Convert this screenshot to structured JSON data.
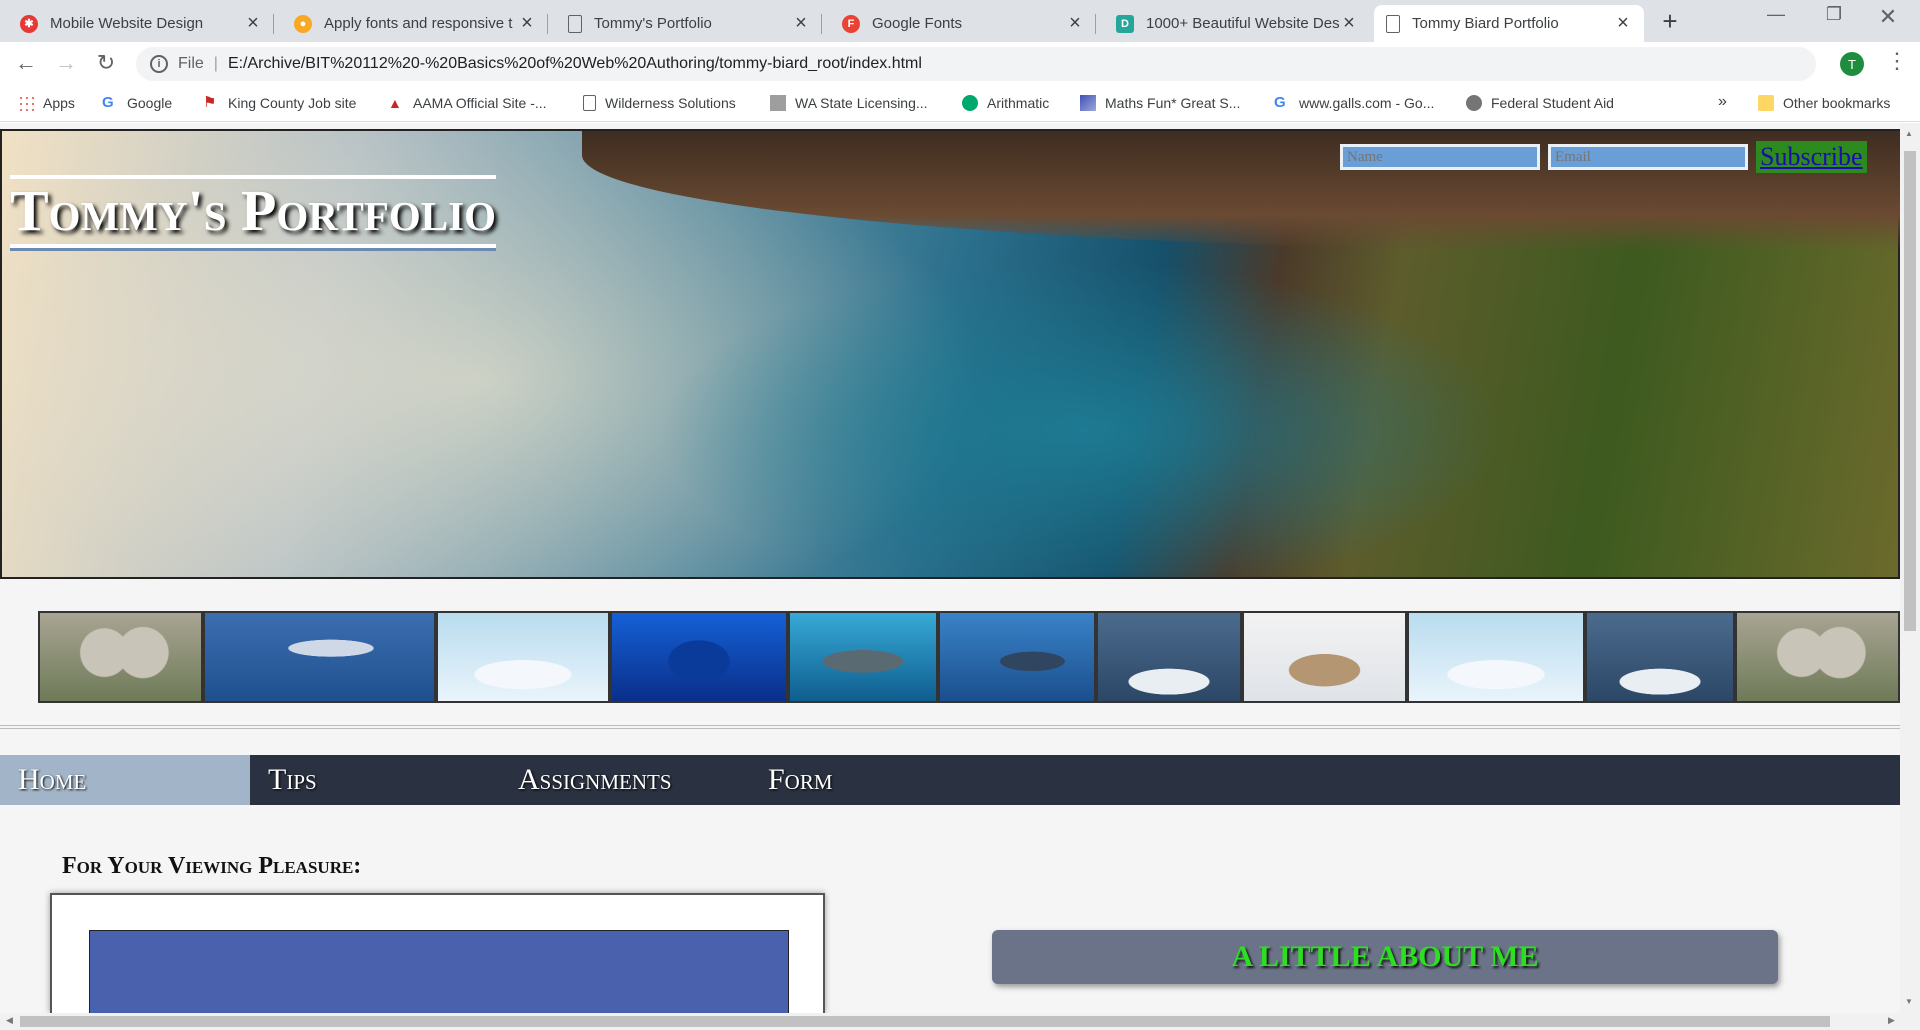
{
  "browser": {
    "tabs": [
      {
        "title": "Mobile Website Design",
        "icon": "mobile-site-icon",
        "color": "#e53935"
      },
      {
        "title": "Apply fonts and responsive t",
        "icon": "canvas-icon",
        "color": "#f9a825"
      },
      {
        "title": "Tommy's Portfolio",
        "icon": "page-icon",
        "color": "#5f6368"
      },
      {
        "title": "Google Fonts",
        "icon": "google-fonts-icon",
        "color": "#ea4335"
      },
      {
        "title": "1000+ Beautiful Website Des",
        "icon": "design-icon",
        "color": "#26a69a"
      },
      {
        "title": "Tommy Biard Portfolio",
        "icon": "page-icon",
        "color": "#5f6368"
      }
    ],
    "url_scheme": "File",
    "url": "E:/Archive/BIT%20112%20-%20Basics%20of%20Web%20Authoring/tommy-biard_root/index.html",
    "profile_initial": "T",
    "bookmarks": [
      {
        "label": "Apps",
        "icon": "apps-grid-icon"
      },
      {
        "label": "Google",
        "icon": "google-icon"
      },
      {
        "label": "King County Job site",
        "icon": "flag-icon"
      },
      {
        "label": "AAMA Official Site -...",
        "icon": "aama-icon"
      },
      {
        "label": "Wilderness Solutions",
        "icon": "page-icon"
      },
      {
        "label": "WA State Licensing...",
        "icon": "licensing-icon"
      },
      {
        "label": "Arithmatic",
        "icon": "arithmatic-icon"
      },
      {
        "label": "Maths Fun* Great S...",
        "icon": "maths-icon"
      },
      {
        "label": "www.galls.com - Go...",
        "icon": "google-icon"
      },
      {
        "label": "Federal Student Aid",
        "icon": "student-aid-icon"
      }
    ],
    "overflow_label": "»",
    "other_bookmarks": "Other bookmarks"
  },
  "page": {
    "site_title": "Tommy's Portfolio",
    "subscribe": {
      "name_placeholder": "Name",
      "email_placeholder": "Email",
      "button_label": "Subscribe"
    },
    "gallery": [
      {
        "alt": "seal-face"
      },
      {
        "alt": "dolphin"
      },
      {
        "alt": "penguins-on-ice"
      },
      {
        "alt": "blue-fish"
      },
      {
        "alt": "whale-shark"
      },
      {
        "alt": "whale-shark-deep"
      },
      {
        "alt": "penguins-on-floe"
      },
      {
        "alt": "seal-on-snow"
      },
      {
        "alt": "penguins-on-ice-2"
      },
      {
        "alt": "penguins-on-floe-2"
      },
      {
        "alt": "seal-face-2"
      }
    ],
    "nav": [
      "Home",
      "Tips",
      "Assignments",
      "Form"
    ],
    "section_heading": "For Your Viewing Pleasure:",
    "about_heading": "A LITTLE ABOUT ME"
  }
}
